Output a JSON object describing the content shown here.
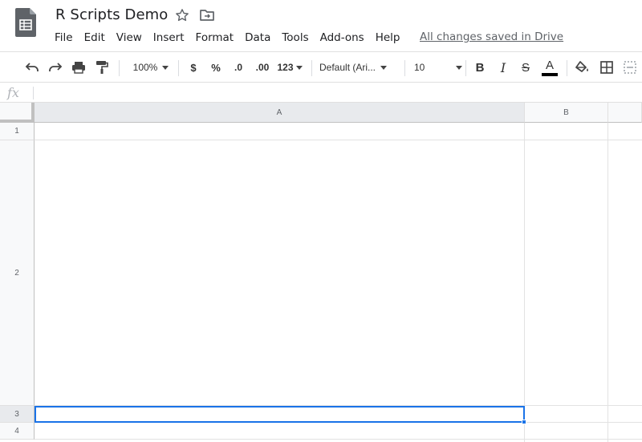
{
  "app": {
    "doc_title": "R Scripts Demo",
    "icons": {
      "doc": "sheets-doc-icon",
      "star": "star-icon",
      "move": "move-to-folder-icon"
    }
  },
  "menu": {
    "items": [
      "File",
      "Edit",
      "View",
      "Insert",
      "Format",
      "Data",
      "Tools",
      "Add-ons",
      "Help"
    ],
    "save_status": "All changes saved in Drive"
  },
  "toolbar": {
    "zoom": "100%",
    "currency": "$",
    "percent": "%",
    "decrease_decimal": ".0",
    "increase_decimal": ".00",
    "number_format": "123",
    "font": "Default (Ari...",
    "font_size": "10",
    "bold": "B",
    "italic": "I",
    "strikethrough": "S",
    "text_color": "A",
    "text_color_value": "#000000"
  },
  "formula_bar": {
    "label": "fx",
    "value": ""
  },
  "sheet": {
    "columns": [
      "A",
      "B"
    ],
    "rows": [
      "1",
      "2",
      "3",
      "4"
    ],
    "selected_cell": "A3",
    "accent": "#1a73e8"
  }
}
